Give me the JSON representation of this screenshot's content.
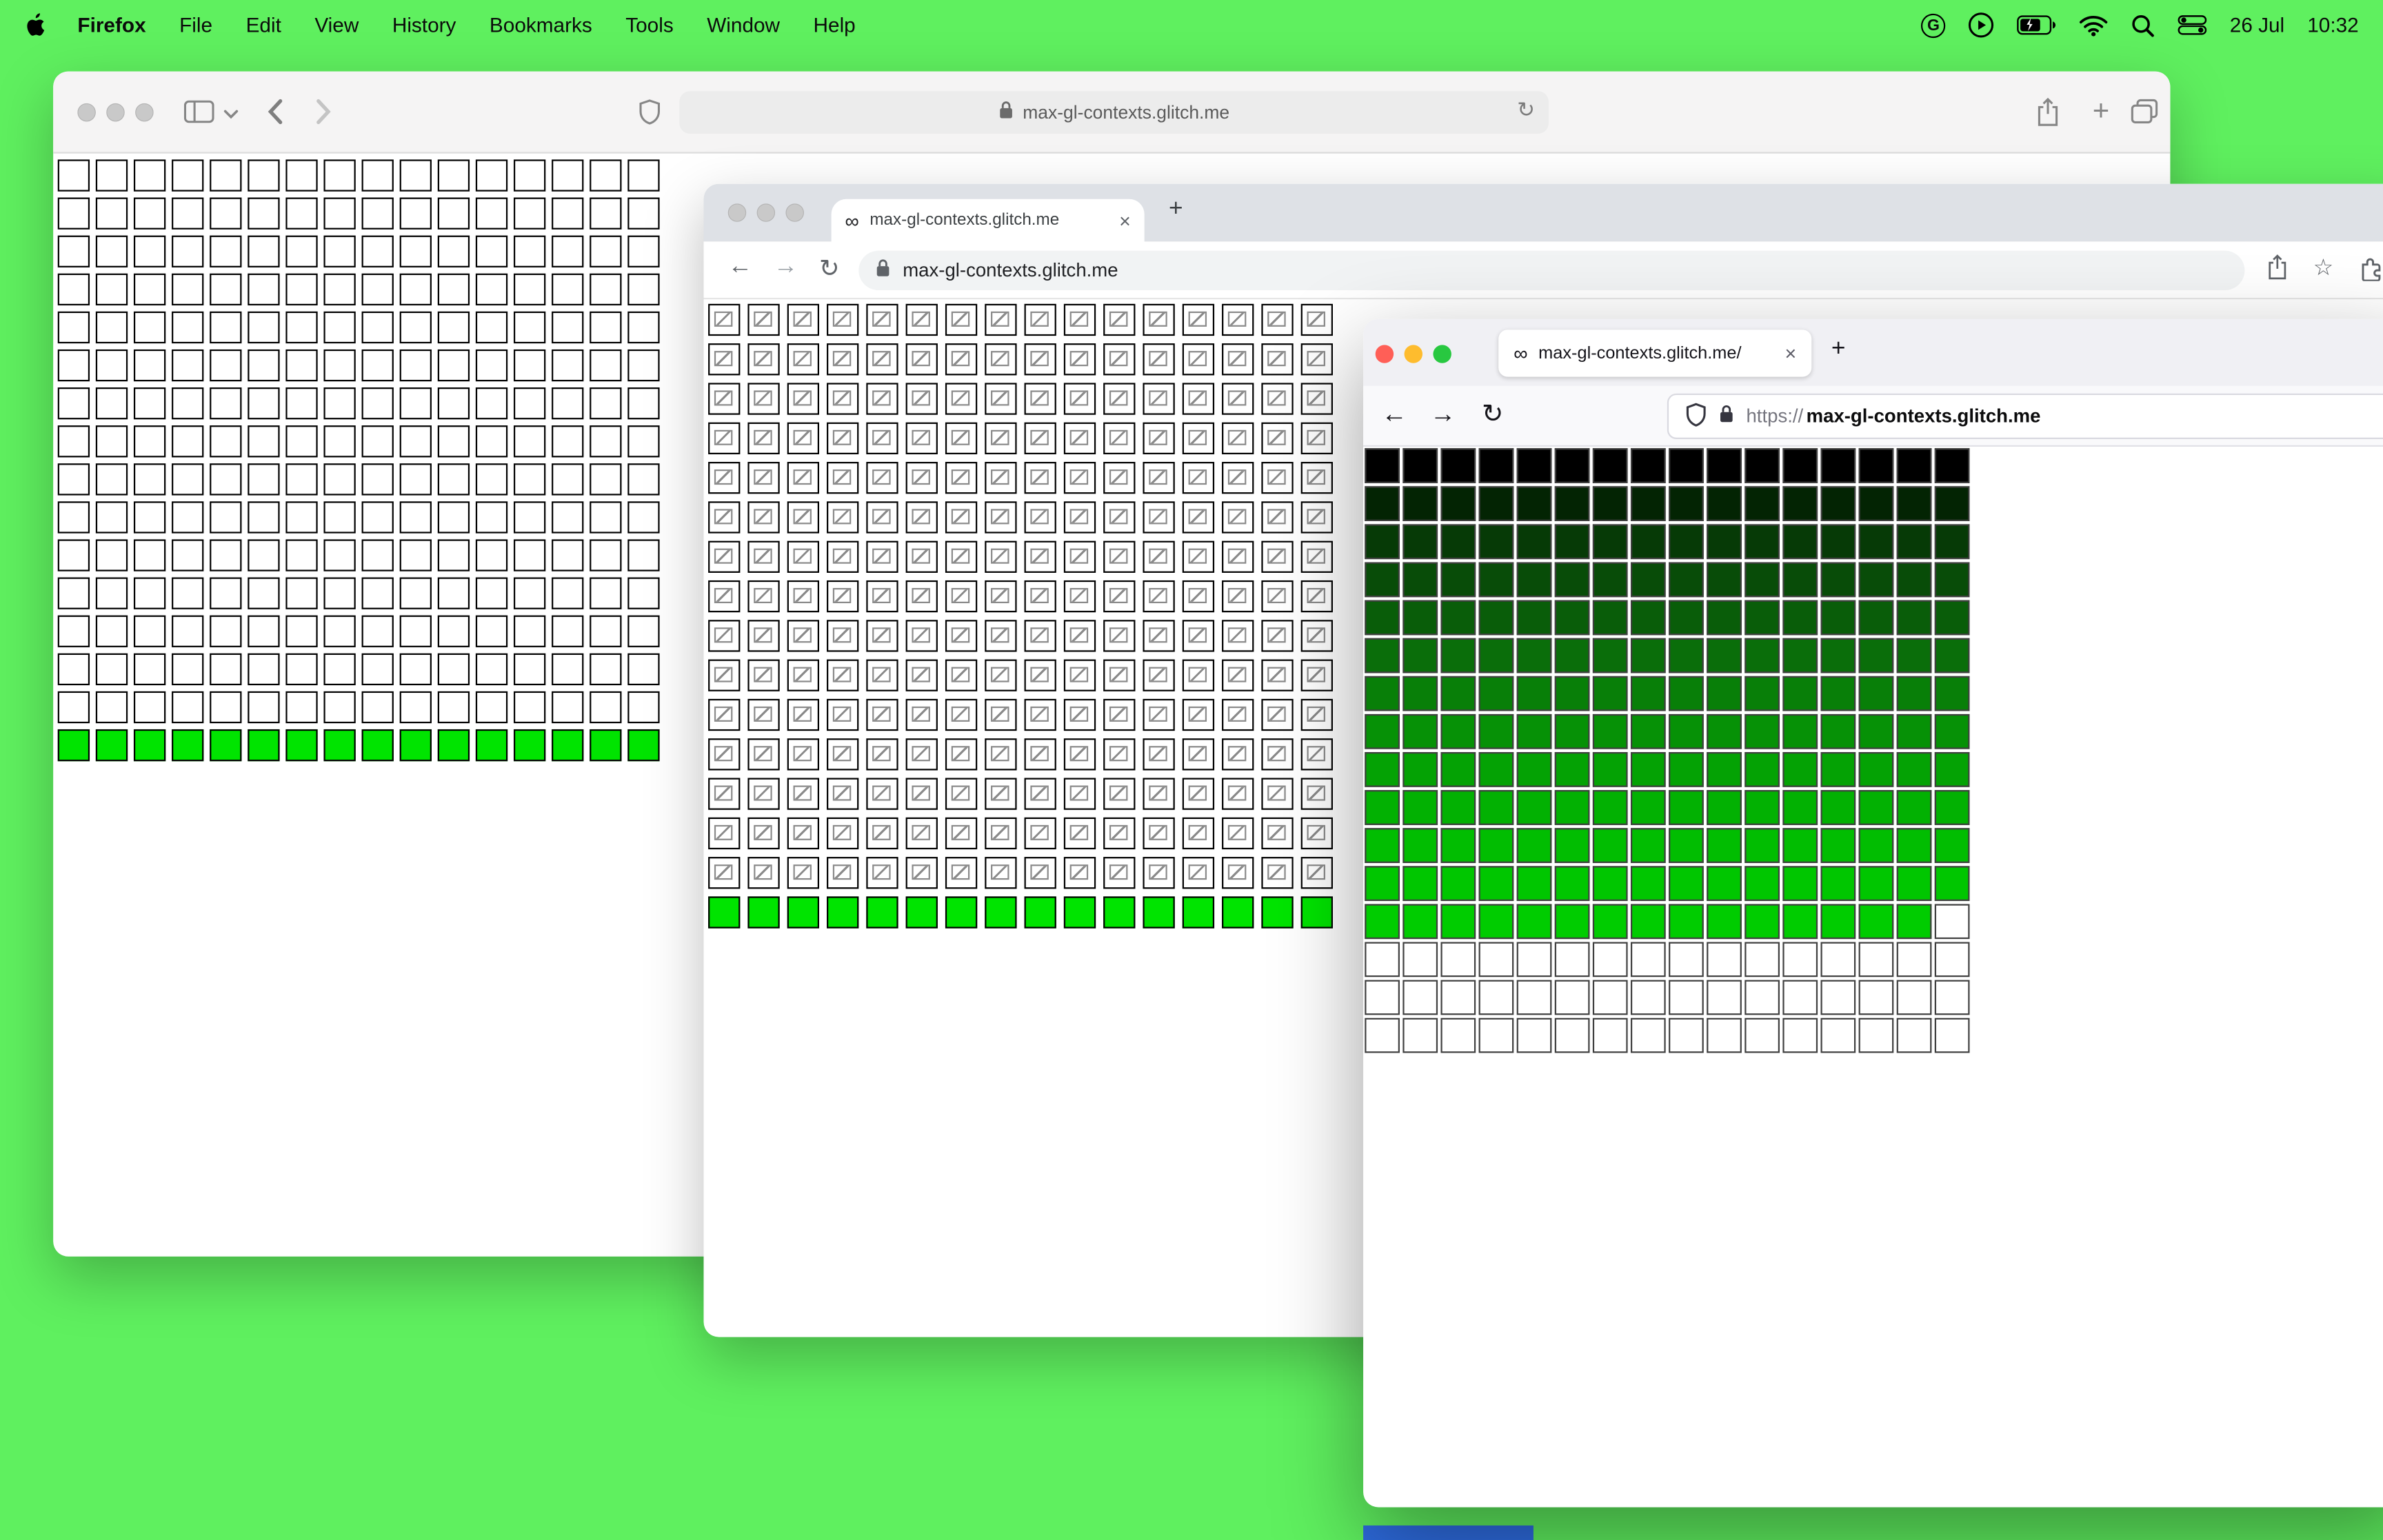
{
  "desktop": {
    "background_color": "#5ff05f",
    "blue_strip_color": "#2e6ce0"
  },
  "menubar": {
    "app_name": "Firefox",
    "items": [
      "File",
      "Edit",
      "View",
      "History",
      "Bookmarks",
      "Tools",
      "Window",
      "Help"
    ],
    "status": {
      "date": "26 Jul",
      "time": "10:32"
    }
  },
  "glyphs": {
    "infinity": "∞",
    "close": "×",
    "plus": "+",
    "back": "←",
    "forward": "→",
    "reload": "↻",
    "star": "☆",
    "g_badge": "G"
  },
  "safari_window": {
    "url": "max-gl-contexts.glitch.me",
    "grid": {
      "cols": 16,
      "rows": 16,
      "row_colors": [
        "#ffffff",
        "#ffffff",
        "#ffffff",
        "#ffffff",
        "#ffffff",
        "#ffffff",
        "#ffffff",
        "#ffffff",
        "#ffffff",
        "#ffffff",
        "#ffffff",
        "#ffffff",
        "#ffffff",
        "#ffffff",
        "#ffffff",
        "#00e400"
      ]
    }
  },
  "chrome_window": {
    "tab_title": "max-gl-contexts.glitch.me",
    "url": "max-gl-contexts.glitch.me",
    "grid": {
      "cols": 16,
      "rows": 16,
      "broken_rows": 15,
      "row_colors": [
        "#ffffff",
        "#ffffff",
        "#ffffff",
        "#ffffff",
        "#ffffff",
        "#ffffff",
        "#ffffff",
        "#ffffff",
        "#ffffff",
        "#ffffff",
        "#ffffff",
        "#ffffff",
        "#ffffff",
        "#ffffff",
        "#ffffff",
        "#00e400"
      ]
    }
  },
  "firefox_window": {
    "tab_title": "max-gl-contexts.glitch.me/",
    "url_scheme": "https://",
    "url_host": "max-gl-contexts.glitch.me",
    "grid": {
      "cols": 16,
      "rows": 16,
      "row_colors": [
        "#000000",
        "#032403",
        "#063a06",
        "#084c08",
        "#095d09",
        "#0a6e0a",
        "#087f08",
        "#069106",
        "#04a204",
        "#02b102",
        "#01bd01",
        "#00c600",
        "#00cc00",
        "#ffffff",
        "#ffffff",
        "#ffffff"
      ],
      "exceptions": [
        {
          "row": 12,
          "col": 15,
          "color": "#ffffff"
        }
      ]
    }
  }
}
